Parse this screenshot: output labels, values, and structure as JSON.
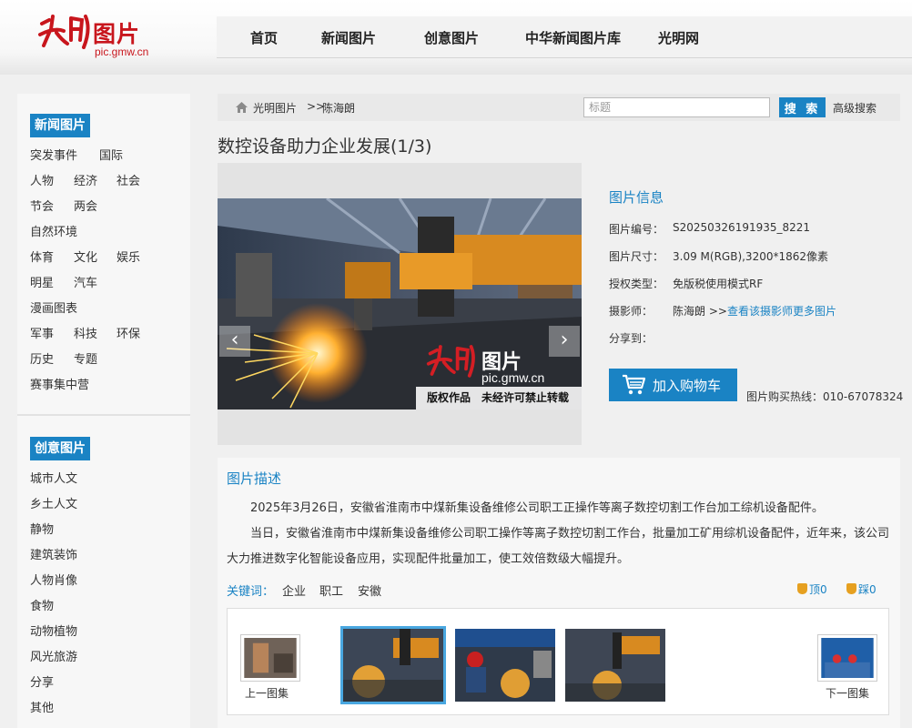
{
  "header": {
    "logo_word": "图片",
    "logo_url": "pic.gmw.cn",
    "nav": [
      "首页",
      "新闻图片",
      "创意图片",
      "中华新闻图片库",
      "光明网"
    ]
  },
  "sidebar": {
    "news_title": "新闻图片",
    "news_items": [
      "突发事件",
      "国际",
      "人物",
      "经济",
      "社会",
      "节会",
      "两会",
      "自然环境",
      "体育",
      "文化",
      "娱乐",
      "明星",
      "汽车",
      "漫画图表",
      "军事",
      "科技",
      "环保",
      "历史",
      "专题",
      "赛事集中营"
    ],
    "creative_title": "创意图片",
    "creative_items": [
      "城市人文",
      "乡土人文",
      "静物",
      "建筑装饰",
      "人物肖像",
      "食物",
      "动物植物",
      "风光旅游",
      "分享",
      "其他"
    ]
  },
  "breadcrumb": {
    "home": "光明图片",
    "separator": ">>",
    "current": "陈海朗",
    "search_placeholder": "标题",
    "search_button": "搜 索",
    "advanced": "高级搜索"
  },
  "page_title": "数控设备助力企业发展(1/3)",
  "viewer": {
    "watermark_word": "图片",
    "watermark_url": "pic.gmw.cn",
    "copyright": "版权作品　未经许可禁止转载",
    "prev_icon": "chevron-left-icon",
    "next_icon": "chevron-right-icon"
  },
  "info": {
    "title": "图片信息",
    "rows": [
      {
        "label": "图片编号：",
        "value": "S20250326191935_8221"
      },
      {
        "label": "图片尺寸：",
        "value": "3.09 M(RGB),3200*1862像素"
      },
      {
        "label": "授权类型：",
        "value": "免版税使用模式RF"
      },
      {
        "label": "摄影师：",
        "value": "陈海朗 >>"
      },
      {
        "label": "分享到：",
        "value": ""
      }
    ],
    "more_link": "查看该摄影师更多图片",
    "cart_button": "加入购物车",
    "hotline": "图片购买热线：010-67078324"
  },
  "description": {
    "title": "图片描述",
    "paragraphs": [
      "2025年3月26日，安徽省淮南市中煤新集设备维修公司职工正操作等离子数控切割工作台加工综机设备配件。",
      "当日，安徽省淮南市中煤新集设备维修公司职工操作等离子数控切割工作台，批量加工矿用综机设备配件，近年来，该公司大力推进数字化智能设备应用，实现配件批量加工，使工效倍数级大幅提升。"
    ],
    "keywords_label": "关键词：",
    "keywords": [
      "企业",
      "职工",
      "安徽"
    ],
    "up_label": "顶0",
    "down_label": "踩0",
    "prev_set": "上一图集",
    "next_set": "下一图集"
  },
  "colors": {
    "accent": "#1a83c4",
    "brand_red": "#c8161d"
  }
}
